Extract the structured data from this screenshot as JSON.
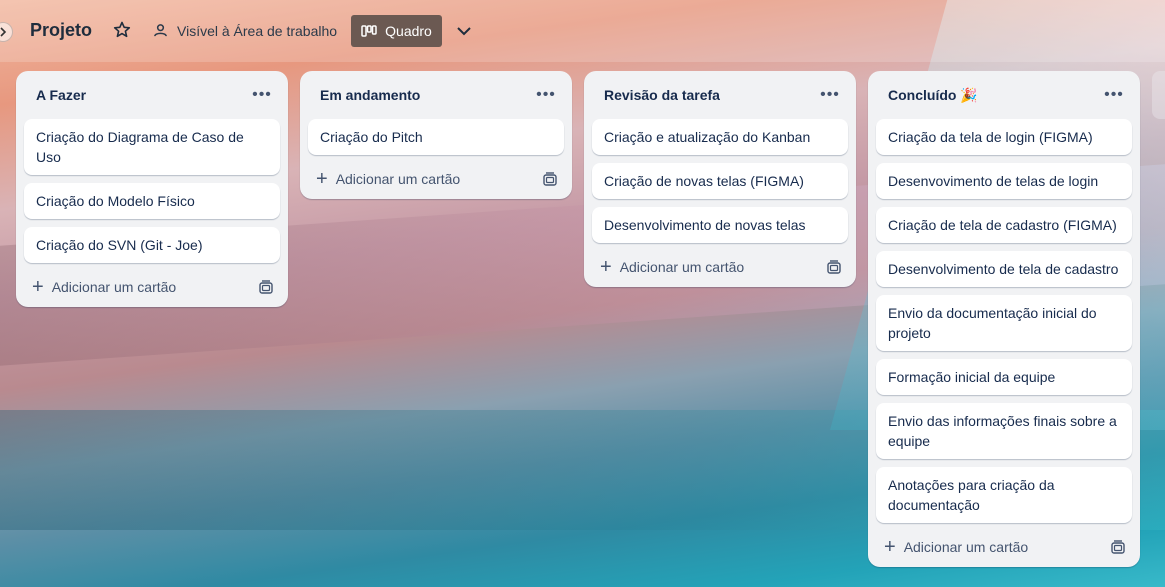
{
  "header": {
    "board_title": "Projeto",
    "visibility_label": "Visível à Área de trabalho",
    "view_label": "Quadro"
  },
  "lists": [
    {
      "title": "A Fazer",
      "cards": [
        "Criação do Diagrama de Caso de Uso",
        "Criação do Modelo Físico",
        "Criação do SVN (Git - Joe)"
      ],
      "add_label": "Adicionar um cartão"
    },
    {
      "title": "Em andamento",
      "cards": [
        "Criação do Pitch"
      ],
      "add_label": "Adicionar um cartão"
    },
    {
      "title": "Revisão da tarefa",
      "cards": [
        "Criação e atualização do Kanban",
        "Criação de novas telas (FIGMA)",
        "Desenvolvimento de novas telas"
      ],
      "add_label": "Adicionar um cartão"
    },
    {
      "title": "Concluído 🎉",
      "cards": [
        "Criação da tela de login (FIGMA)",
        "Desenvovimento de telas de login",
        "Criação de tela de cadastro (FIGMA)",
        "Desenvolvimento de tela de cadastro",
        "Envio da documentação inicial do projeto",
        "Formação inicial da equipe",
        "Envio das informações finais sobre a equipe",
        "Anotações para criação da documentação"
      ],
      "add_label": "Adicionar um cartão"
    }
  ],
  "icons": {
    "menu": "ellipsis-icon",
    "add": "plus-icon",
    "template": "card-template-icon"
  }
}
